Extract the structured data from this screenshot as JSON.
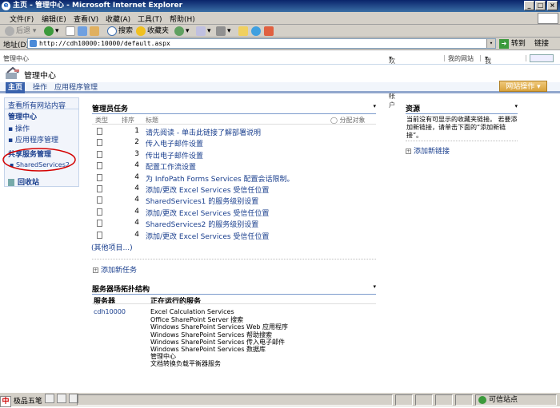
{
  "window": {
    "title": "主页 - 管理中心 - Microsoft Internet Explorer",
    "menu": [
      "文件(F)",
      "编辑(E)",
      "查看(V)",
      "收藏(A)",
      "工具(T)",
      "帮助(H)"
    ]
  },
  "toolbar": {
    "back": "后退",
    "search": "搜索",
    "favorites": "收藏夹"
  },
  "address": {
    "label": "地址(D)",
    "url": "http://cdh10000:10000/default.aspx",
    "go": "转到",
    "links": "链接"
  },
  "site": {
    "crumb": "管理中心",
    "welcome": "欢迎 系统帐户",
    "my_site": "我的网站",
    "my_links": "我的链接",
    "title": "管理中心",
    "tabs": [
      "主页",
      "操作",
      "应用程序管理"
    ],
    "site_actions": "网站操作"
  },
  "leftnav": {
    "view_all": "查看所有网站内容",
    "central": "管理中心",
    "ops": "操作",
    "app_mgmt": "应用程序管理",
    "shared_services": "共享服务管理",
    "ssp": "SharedServices2",
    "recycle": "回收站"
  },
  "tasks": {
    "title": "管理员任务",
    "cols": {
      "type": "类型",
      "order": "排序",
      "title": "标题",
      "assigned": "分配对象"
    },
    "rows": [
      {
        "order": "1",
        "title": "请先阅读 - 单击此链接了解部署说明"
      },
      {
        "order": "2",
        "title": "传入电子邮件设置"
      },
      {
        "order": "3",
        "title": "传出电子邮件设置"
      },
      {
        "order": "4",
        "title": "配置工作流设置"
      },
      {
        "order": "4",
        "title": "为 InfoPath Forms Services 配置会话限制。"
      },
      {
        "order": "4",
        "title": "添加/更改 Excel Services 受信任位置"
      },
      {
        "order": "4",
        "title": "SharedServices1 的服务级别设置"
      },
      {
        "order": "4",
        "title": "添加/更改 Excel Services 受信任位置"
      },
      {
        "order": "4",
        "title": "SharedServices2 的服务级别设置"
      },
      {
        "order": "4",
        "title": "添加/更改 Excel Services 受信任位置"
      }
    ],
    "more": "(其他项目...)",
    "add": "添加新任务"
  },
  "resources": {
    "title": "资源",
    "body": "当前没有可显示的收藏夹链接。 若要添加新链接，请单击下面的“添加新链接”。",
    "add": "添加新链接"
  },
  "topology": {
    "title": "服务器场拓扑结构",
    "cols": {
      "server": "服务器",
      "services": "正在运行的服务"
    },
    "server": "cdh10000",
    "services": [
      "Excel Calculation Services",
      "Office SharePoint Server 搜索",
      "Windows SharePoint Services Web 应用程序",
      "Windows SharePoint Services 帮助搜索",
      "Windows SharePoint Services 传入电子邮件",
      "Windows SharePoint Services 数据库",
      "管理中心",
      "文档转换负载平衡器服务"
    ]
  },
  "status": {
    "zone": "可信站点",
    "ime": "极品五笔"
  },
  "colors": {
    "link": "#1a3f8e",
    "tab_active": "#3a63ad",
    "annotation": "#d40000"
  }
}
